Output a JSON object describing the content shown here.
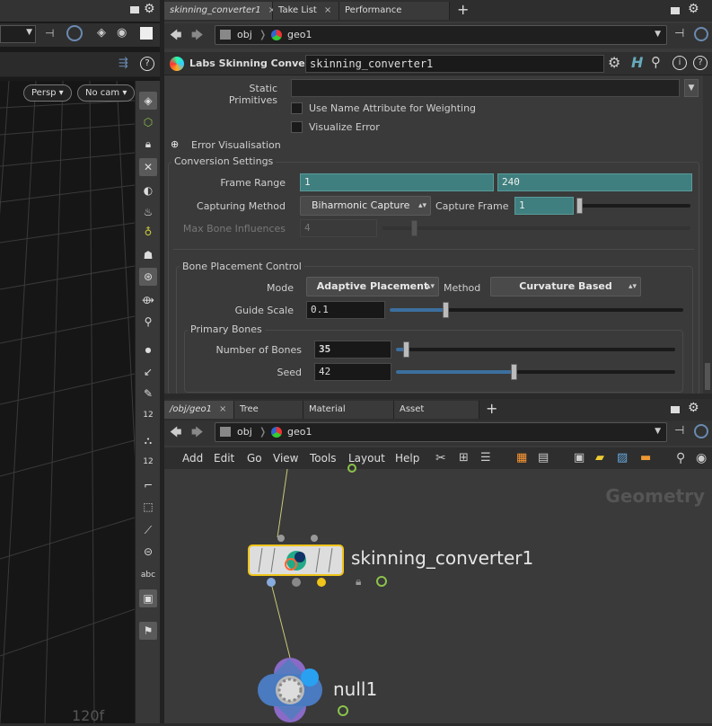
{
  "viewport": {
    "persp_label": "Persp",
    "cam_label": "No cam",
    "grid_number": "120f",
    "shelf_text_12": "12",
    "shelf_text_12b": "12",
    "shelf_text_abc": "abc"
  },
  "param_pane": {
    "tabs": [
      {
        "label": "skinning_converter1",
        "close": "×"
      },
      {
        "label": "Take List",
        "close": "×"
      },
      {
        "label": "Performance Monitor",
        "close": "×"
      }
    ],
    "add_tab": "+",
    "path": {
      "obj": "obj",
      "geo": "geo1"
    },
    "node_type": "Labs Skinning Converter",
    "node_name": "skinning_converter1",
    "static_primitives_label": "Static Primitives",
    "static_primitives_value": "",
    "use_name_attr_label": "Use Name Attribute for Weighting",
    "visualize_error_label": "Visualize Error",
    "error_vis_label": "Error Visualisation",
    "conversion_settings": {
      "title": "Conversion Settings",
      "frame_range_label": "Frame Range",
      "frame_start": "1",
      "frame_end": "240",
      "capturing_method_label": "Capturing Method",
      "capturing_method_value": "Biharmonic Capture",
      "capture_frame_label": "Capture Frame",
      "capture_frame_value": "1",
      "max_bone_label": "Max Bone Influences",
      "max_bone_value": "4"
    },
    "bone_placement": {
      "title": "Bone Placement Control",
      "mode_label": "Mode",
      "mode_value": "Adaptive Placement",
      "method_label": "Method",
      "method_value": "Curvature Based",
      "guide_scale_label": "Guide Scale",
      "guide_scale_value": "0.1",
      "guide_scale_level": 0.19,
      "primary_bones": {
        "title": "Primary Bones",
        "num_bones_label": "Number of Bones",
        "num_bones_value": "35",
        "num_bones_level": 0.035,
        "seed_label": "Seed",
        "seed_value": "42",
        "seed_level": 0.42
      }
    }
  },
  "network_pane": {
    "tabs": [
      {
        "label": "/obj/geo1",
        "close": "×"
      },
      {
        "label": "Tree View",
        "close": "×"
      },
      {
        "label": "Material Palette",
        "close": "×"
      },
      {
        "label": "Asset Browser",
        "close": "×"
      }
    ],
    "add_tab": "+",
    "path": {
      "obj": "obj",
      "geo": "geo1"
    },
    "menu": [
      "Add",
      "Edit",
      "Go",
      "View",
      "Tools",
      "Layout",
      "Help"
    ],
    "context_label": "Geometry",
    "nodes": {
      "skinning": "skinning_converter1",
      "null": "null1"
    }
  },
  "colors": {
    "teal_field": "#3f7f7f",
    "slider_fill": "#3b6f9e",
    "node_highlight": "#f0c419",
    "wire": "#c8c878"
  }
}
